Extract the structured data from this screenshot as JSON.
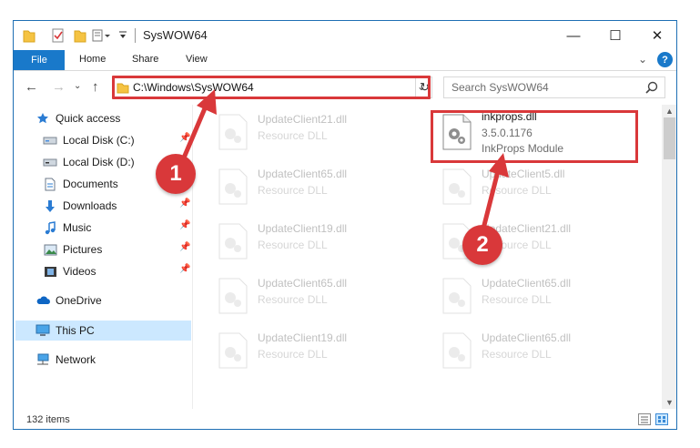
{
  "window": {
    "title": "SysWOW64"
  },
  "ribbon": {
    "file": "File",
    "tabs": [
      "Home",
      "Share",
      "View"
    ],
    "help": "?"
  },
  "nav": {
    "address": "C:\\Windows\\SysWOW64",
    "search_placeholder": "Search SysWOW64"
  },
  "sidebar": {
    "items": [
      {
        "label": "Quick access",
        "icon": "star-icon"
      },
      {
        "label": "Local Disk (C:)",
        "icon": "drive-icon"
      },
      {
        "label": "Local Disk (D:)",
        "icon": "drive-icon"
      },
      {
        "label": "Documents",
        "icon": "documents-icon"
      },
      {
        "label": "Downloads",
        "icon": "download-icon"
      },
      {
        "label": "Music",
        "icon": "music-icon"
      },
      {
        "label": "Pictures",
        "icon": "pictures-icon"
      },
      {
        "label": "Videos",
        "icon": "videos-icon"
      },
      {
        "label": "OneDrive",
        "icon": "cloud-icon"
      },
      {
        "label": "This PC",
        "icon": "computer-icon"
      },
      {
        "label": "Network",
        "icon": "network-icon"
      }
    ],
    "selected": "This PC"
  },
  "files": {
    "left": [
      {
        "name": "UpdateClient21.dll",
        "type": "Resource DLL"
      },
      {
        "name": "UpdateClient65.dll",
        "type": "Resource DLL"
      },
      {
        "name": "UpdateClient19.dll",
        "type": "Resource DLL"
      },
      {
        "name": "UpdateClient65.dll",
        "type": "Resource DLL"
      },
      {
        "name": "UpdateClient19.dll",
        "type": "Resource DLL"
      }
    ],
    "highlighted": {
      "name": "inkprops.dll",
      "version": "3.5.0.1176",
      "description": "InkProps Module"
    },
    "right": [
      {
        "name": "UpdateClient5.dll",
        "type": "Resource DLL"
      },
      {
        "name": "UpdateClient21.dll",
        "type": "Resource DLL"
      },
      {
        "name": "UpdateClient65.dll",
        "type": "Resource DLL"
      },
      {
        "name": "UpdateClient65.dll",
        "type": "Resource DLL"
      }
    ]
  },
  "status": {
    "count": "132 items"
  },
  "callouts": {
    "step1": "1",
    "step2": "2"
  },
  "colors": {
    "accent": "#1979ca",
    "highlight": "#d9383a",
    "selection": "#cce8ff"
  }
}
